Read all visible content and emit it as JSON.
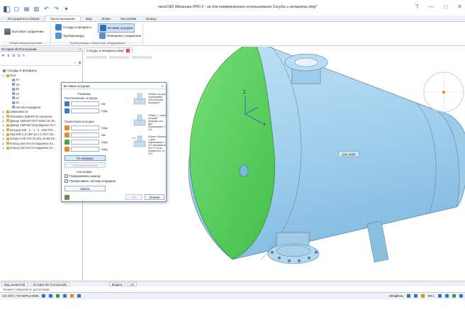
{
  "titlebar": {
    "title": "nanoCAD Механика PRO 2 - не для коммерческого использования Сосуды и аппараты.dwg*",
    "help": "?",
    "min": "—",
    "max": "□",
    "close": "✕"
  },
  "qat": [
    "◧",
    "▢",
    "▤",
    "▥",
    "↶",
    "↷",
    "▾"
  ],
  "ribbon": {
    "tabs": [
      "Инструменты сборки",
      "Проектирование",
      "Вид",
      "Знаки",
      "Настройки",
      "Вывод"
    ],
    "active_tab": 1,
    "groups": [
      {
        "label": "Общее машиностроение",
        "buttons": [
          "Болтовое соединение"
        ]
      },
      {
        "label": "Трубопроводы и емкостное оборудование",
        "buttons": [
          "Сосуды и аппараты",
          "Трубопроводы",
          "Вставка штуцера",
          "Фланцевое соединение"
        ]
      }
    ]
  },
  "left_panel": {
    "header": "История 3D Построений",
    "root": "Сосуды и аппараты",
    "tree": [
      {
        "label": "ПСК",
        "level": 0,
        "arrow": "▾",
        "icon": "folder"
      },
      {
        "label": "XY",
        "level": 1,
        "arrow": "",
        "icon": "plane"
      },
      {
        "label": "YZ",
        "level": 1,
        "arrow": "",
        "icon": "plane"
      },
      {
        "label": "ZX",
        "level": 1,
        "arrow": "",
        "icon": "plane"
      },
      {
        "label": "oX",
        "level": 1,
        "arrow": "",
        "icon": "axis"
      },
      {
        "label": "oY",
        "level": 1,
        "arrow": "",
        "icon": "axis"
      },
      {
        "label": "oZ",
        "level": 1,
        "arrow": "",
        "icon": "axis"
      },
      {
        "label": "Начало координат",
        "level": 1,
        "arrow": "",
        "icon": "point"
      },
      {
        "label": "Зависимости",
        "level": 0,
        "arrow": "▸",
        "icon": "folder"
      },
      {
        "label": "Обечайка 1500х8 По внутренн...",
        "level": 0,
        "arrow": "▸",
        "icon": "part"
      },
      {
        "label": "Днище 1500х8 ГОСТ 6533-78 Эл...",
        "level": 0,
        "arrow": "▸",
        "icon": "part"
      },
      {
        "label": "Днище 1500х8 полусферное по Г...",
        "level": 0,
        "arrow": "▸",
        "icon": "part"
      },
      {
        "label": "Штуцер 400 - 1 - 1 - 1 - 200 АТК...",
        "level": 0,
        "arrow": "▸",
        "icon": "part"
      },
      {
        "label": "Люк 500-1,6-160-1а-1-1 ОСТ 26-...",
        "level": 0,
        "arrow": "▸",
        "icon": "part"
      },
      {
        "label": "Опора 3-38 АТК 24.201.10-90 Оп...",
        "level": 0,
        "arrow": "▸",
        "icon": "part"
      },
      {
        "label": "Кольцо жесткости наружное 3х...",
        "level": 0,
        "arrow": "▸",
        "icon": "part"
      },
      {
        "label": "Кольцо жесткости наружное 3х...",
        "level": 0,
        "arrow": "▸",
        "icon": "part"
      }
    ]
  },
  "document": {
    "tab": "Сосуды и аппараты.dwg*"
  },
  "viewport": {
    "dimension": "-200.4000"
  },
  "dialog": {
    "title": "Вставка штуцера",
    "sizes_header": "Размеры",
    "location_label": "Расположение штуцера",
    "orientation_label": "Ориентация штуцера",
    "unit_mm": "мм",
    "unit_deg": "град",
    "loc_values": [
      "",
      ""
    ],
    "ori_values": [
      "",
      "",
      "",
      ""
    ],
    "btn_default": "По нормали",
    "btn_reverse": "Противоположное",
    "settings_header": "Настройки",
    "chk_draw": "Разворачивать камеру",
    "chk_system": "Поворачивать систему координат",
    "btn_save": "Запись",
    "btn_ok": "ОК",
    "btn_cancel": "Отмена",
    "desc1": "Объект оси для образования угла наклона штуцера R",
    "desc2": "Объект 1, через который проходит ось, для образования: С и D",
    "desc3": "Объект объекта 1. Для образования: C и D направлена ось OY если неизвестно, то OY)"
  },
  "bottom_tabs": [
    "Вид элементов",
    "История 3D Построений",
    "Модель",
    "А4"
  ],
  "hint": "Укажите поверхность для вставки",
  "status": {
    "coords": "127.3271,-757.8876,0.0000",
    "scale": "ЭКОДЕНЬ",
    "right": "М4:1"
  }
}
